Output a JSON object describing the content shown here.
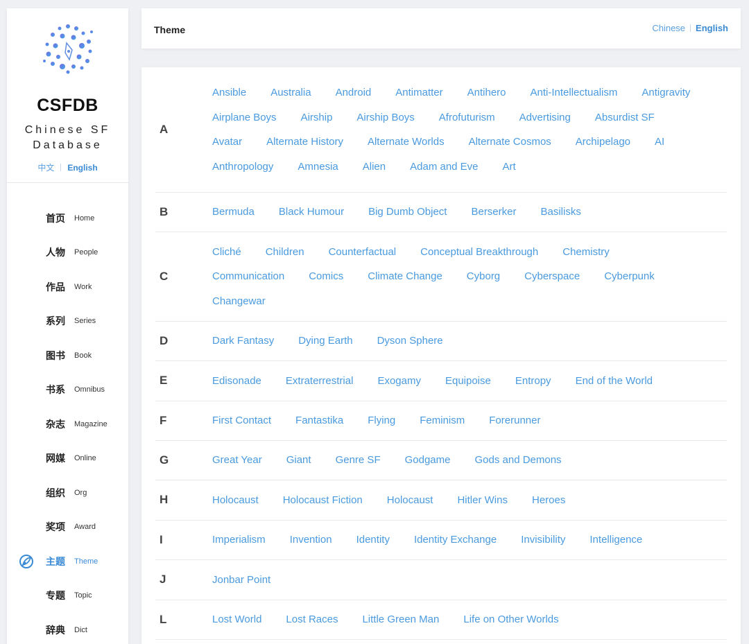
{
  "brand": {
    "title": "CSFDB",
    "subtitle": "Chinese SF Database",
    "lang_zh": "中文",
    "lang_en": "English"
  },
  "nav": [
    {
      "zh": "首页",
      "en": "Home"
    },
    {
      "zh": "人物",
      "en": "People"
    },
    {
      "zh": "作品",
      "en": "Work"
    },
    {
      "zh": "系列",
      "en": "Series"
    },
    {
      "zh": "图书",
      "en": "Book"
    },
    {
      "zh": "书系",
      "en": "Omnibus"
    },
    {
      "zh": "杂志",
      "en": "Magazine"
    },
    {
      "zh": "网媒",
      "en": "Online"
    },
    {
      "zh": "组织",
      "en": "Org"
    },
    {
      "zh": "奖项",
      "en": "Award"
    },
    {
      "zh": "主题",
      "en": "Theme",
      "active": true,
      "icon": "theme-icon"
    },
    {
      "zh": "专题",
      "en": "Topic"
    },
    {
      "zh": "辞典",
      "en": "Dict"
    }
  ],
  "header": {
    "title": "Theme",
    "lang_chinese": "Chinese",
    "lang_english": "English"
  },
  "groups": [
    {
      "letter": "A",
      "topics": [
        "Ansible",
        "Australia",
        "Android",
        "Antimatter",
        "Antihero",
        "Anti-Intellectualism",
        "Antigravity",
        "Airplane Boys",
        "Airship",
        "Airship Boys",
        "Afrofuturism",
        "Advertising",
        "Absurdist SF",
        "Avatar",
        "Alternate History",
        "Alternate Worlds",
        "Alternate Cosmos",
        "Archipelago",
        "AI",
        "Anthropology",
        "Amnesia",
        "Alien",
        "Adam and Eve",
        "Art"
      ]
    },
    {
      "letter": "B",
      "topics": [
        "Bermuda",
        "Black Humour",
        "Big Dumb Object",
        "Berserker",
        "Basilisks"
      ]
    },
    {
      "letter": "C",
      "topics": [
        "Cliché",
        "Children",
        "Counterfactual",
        "Conceptual Breakthrough",
        "Chemistry",
        "Communication",
        "Comics",
        "Climate Change",
        "Cyborg",
        "Cyberspace",
        "Cyberpunk",
        "Changewar"
      ]
    },
    {
      "letter": "D",
      "topics": [
        "Dark Fantasy",
        "Dying Earth",
        "Dyson Sphere"
      ]
    },
    {
      "letter": "E",
      "topics": [
        "Edisonade",
        "Extraterrestrial",
        "Exogamy",
        "Equipoise",
        "Entropy",
        "End of the World"
      ]
    },
    {
      "letter": "F",
      "topics": [
        "First Contact",
        "Fantastika",
        "Flying",
        "Feminism",
        "Forerunner"
      ]
    },
    {
      "letter": "G",
      "topics": [
        "Great Year",
        "Giant",
        "Genre SF",
        "Godgame",
        "Gods and Demons"
      ]
    },
    {
      "letter": "H",
      "topics": [
        "Holocaust",
        "Holocaust Fiction",
        "Holocaust",
        "Hitler Wins",
        "Heroes"
      ]
    },
    {
      "letter": "I",
      "topics": [
        "Imperialism",
        "Invention",
        "Identity",
        "Identity Exchange",
        "Invisibility",
        "Intelligence"
      ]
    },
    {
      "letter": "J",
      "topics": [
        "Jonbar Point"
      ]
    },
    {
      "letter": "L",
      "topics": [
        "Lost World",
        "Lost Races",
        "Little Green Man",
        "Life on Other Worlds"
      ]
    }
  ],
  "colors": {
    "accent": "#3a8ad4",
    "link": "#4a9adf",
    "background": "#eef0f4"
  }
}
